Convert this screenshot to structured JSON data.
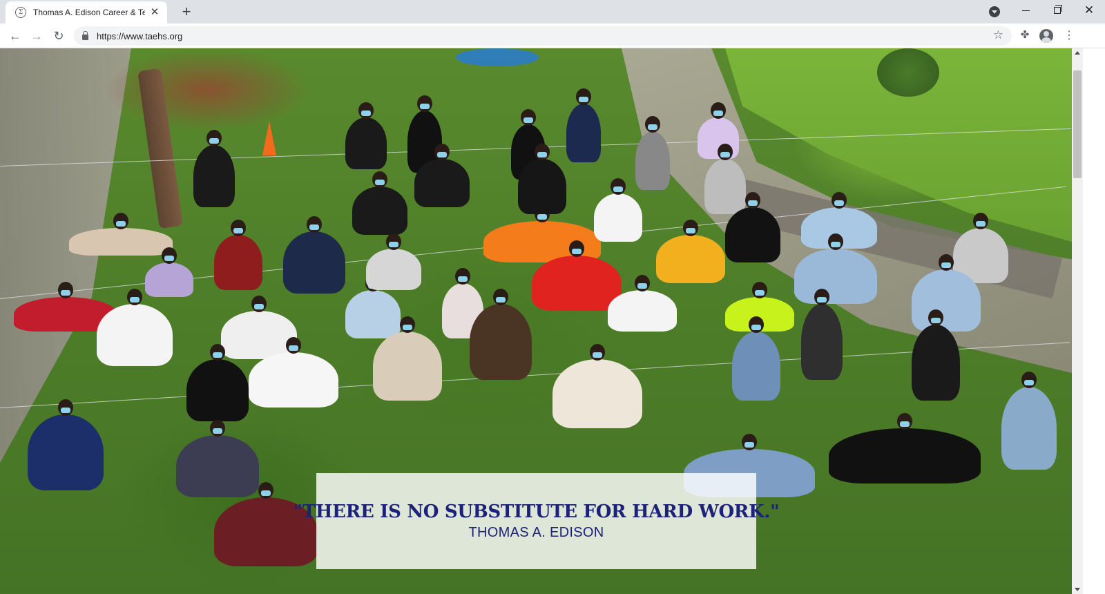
{
  "browser": {
    "tab": {
      "title": "Thomas A. Edison Career & Technical",
      "favicon": "school-crest-icon",
      "close_icon": "close-icon"
    },
    "new_tab_icon": "plus-icon",
    "window_controls": [
      "minimize-icon",
      "restore-icon",
      "close-icon"
    ],
    "nav": {
      "back_icon": "arrow-left-icon",
      "forward_icon": "arrow-right-icon",
      "reload_icon": "reload-icon"
    },
    "omnibox": {
      "url": "https://www.taehs.org",
      "secure_icon": "lock-icon",
      "bookmark_icon": "star-icon"
    },
    "toolbar_icons": [
      "extensions-icon",
      "profile-icon",
      "more-vert-icon"
    ]
  },
  "hero": {
    "description_icon": "photo",
    "quote": {
      "text": "\"THERE IS NO SUBSTITUTE FOR HARD WORK.\"",
      "author": "THOMAS A. EDISON"
    }
  },
  "colors": {
    "quote_text": "#1c2279",
    "tabstrip_bg": "#dee1e6",
    "omnibox_bg": "#f1f3f4"
  }
}
